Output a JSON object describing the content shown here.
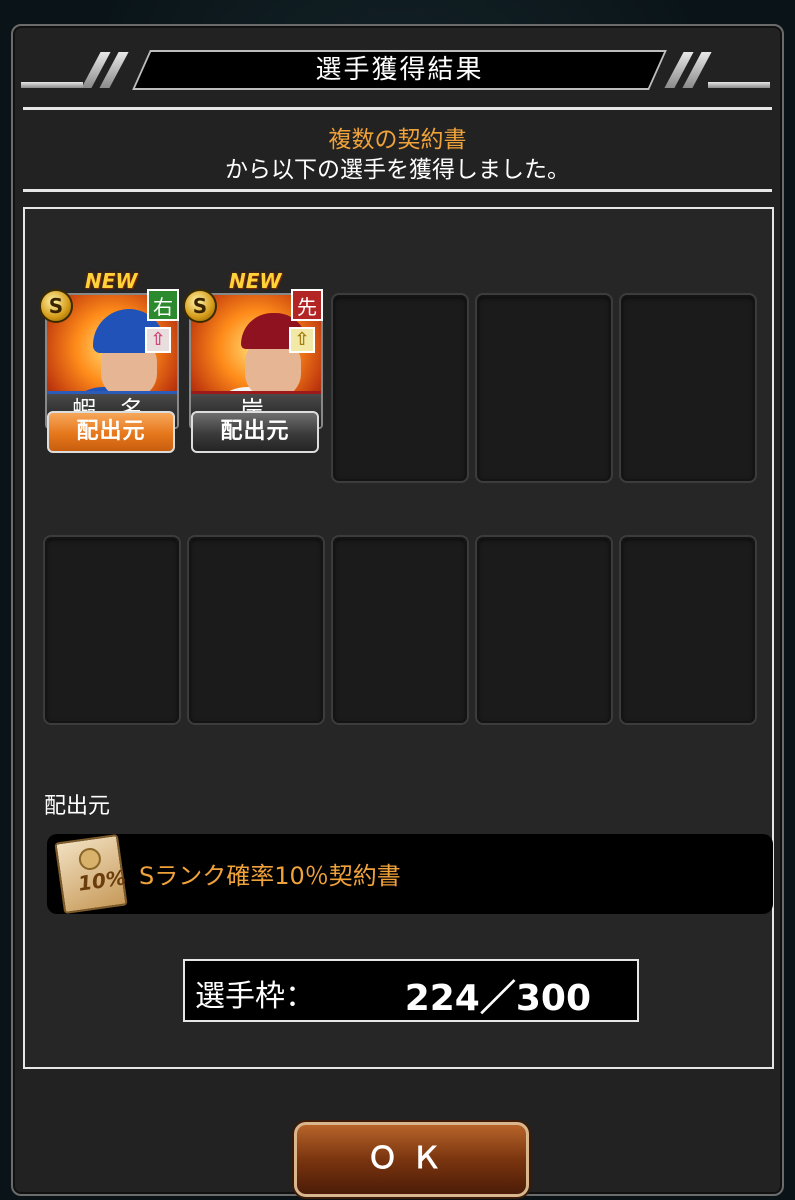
{
  "dialog": {
    "title": "選手獲得結果",
    "subtitle_highlight": "複数の契約書",
    "subtitle_rest": "から以下の選手を獲得しました。"
  },
  "cards": [
    {
      "name": "蝦 名",
      "new_label": "NEW",
      "rank": "S",
      "position": "右",
      "source_button": "配出元",
      "active": true
    },
    {
      "name": "岸",
      "new_label": "NEW",
      "rank": "S",
      "position": "先",
      "source_button": "配出元",
      "active": false
    }
  ],
  "source": {
    "label": "配出元",
    "item_text": "Sランク確率10％契約書",
    "ticket_text": "10%",
    "ticket_rank": "S"
  },
  "roster": {
    "label": "選手枠：",
    "value": "224／300"
  },
  "ok_label": "ＯＫ",
  "colors": {
    "accent_orange": "#f0a23a",
    "panel": "#262626"
  }
}
